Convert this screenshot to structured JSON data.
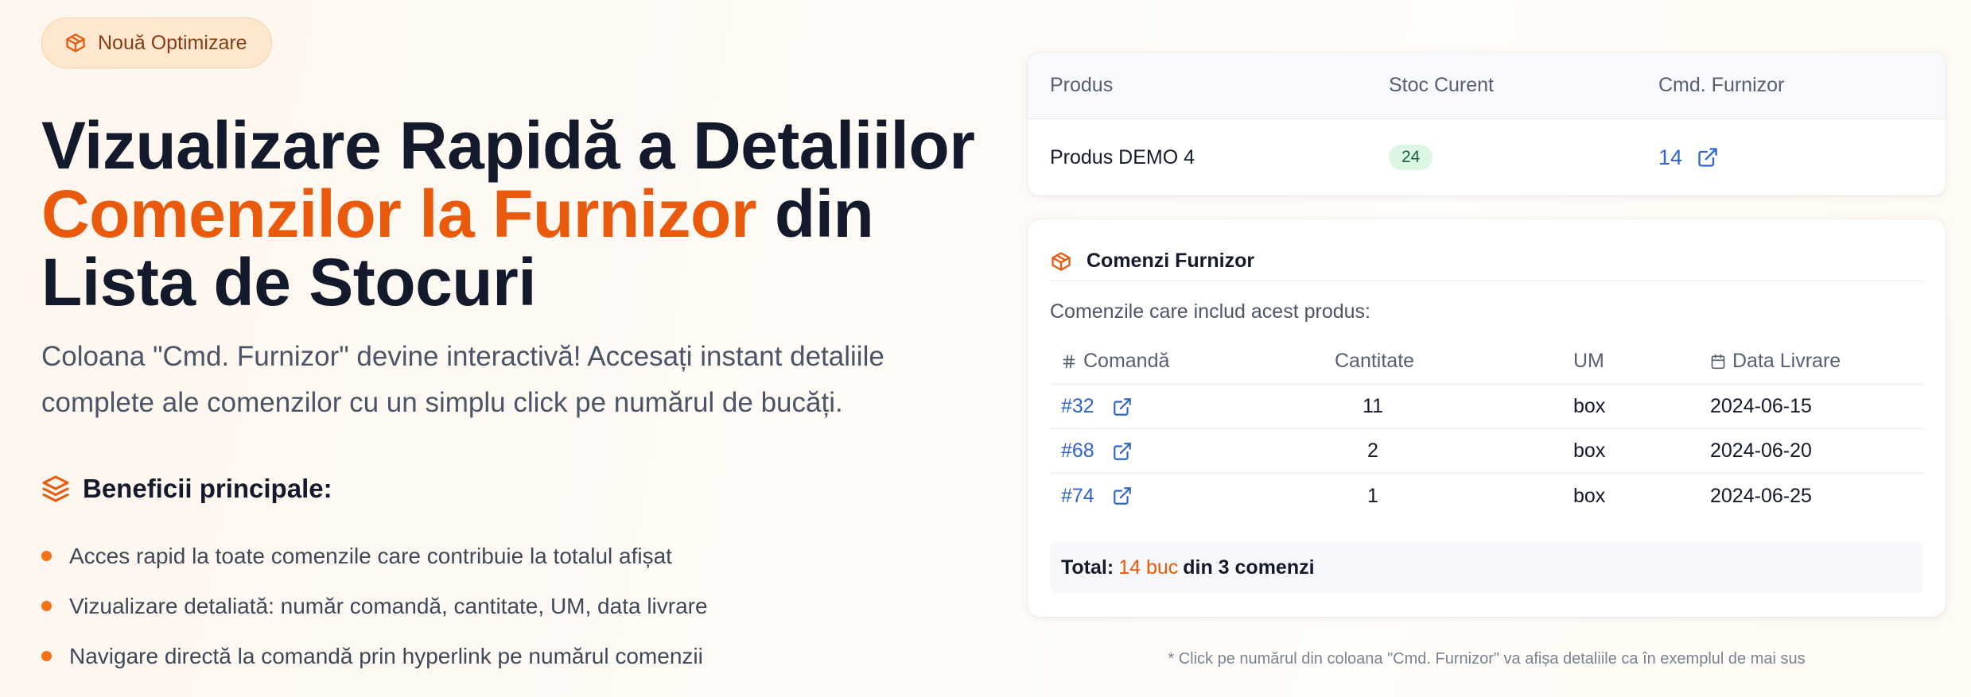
{
  "badge": {
    "label": "Nouă Optimizare",
    "icon": "package-icon"
  },
  "headline": {
    "part1": "Vizualizare Rapidă a Detaliilor ",
    "accent": "Comenzilor la Furnizor",
    "part2": " din Lista de Stocuri"
  },
  "lead": "Coloana \"Cmd. Furnizor\" devine interactivă! Accesați instant detaliile complete ale comenzilor cu un simplu click pe numărul de bucăți.",
  "benefits": {
    "title": "Beneficii principale:",
    "icon": "layers-icon",
    "items": [
      "Acces rapid la toate comenzile care contribuie la totalul afișat",
      "Vizualizare detaliată: număr comandă, cantitate, UM, data livrare",
      "Navigare directă la comandă prin hyperlink pe numărul comenzii"
    ]
  },
  "stock_table": {
    "headers": [
      "Produs",
      "Stoc Curent",
      "Cmd. Furnizor"
    ],
    "row": {
      "product": "Produs DEMO 4",
      "stock": "24",
      "supplier_orders": "14"
    }
  },
  "orders_card": {
    "title": "Comenzi Furnizor",
    "subtitle": "Comenzile care includ acest produs:",
    "headers": {
      "order": "Comandă",
      "qty": "Cantitate",
      "um": "UM",
      "date": "Data Livrare"
    },
    "rows": [
      {
        "order": "#32",
        "qty": "11",
        "um": "box",
        "date": "2024-06-15"
      },
      {
        "order": "#68",
        "qty": "2",
        "um": "box",
        "date": "2024-06-20"
      },
      {
        "order": "#74",
        "qty": "1",
        "um": "box",
        "date": "2024-06-25"
      }
    ],
    "total": {
      "label": "Total:",
      "value": "14 buc",
      "suffix": "din 3 comenzi"
    }
  },
  "footnote": "* Click pe numărul din coloana \"Cmd. Furnizor\" va afișa detaliile ca în exemplul de mai sus",
  "colors": {
    "accent": "#ea5a0c",
    "link": "#2f64c8",
    "pill_bg": "#dcf6e4"
  }
}
